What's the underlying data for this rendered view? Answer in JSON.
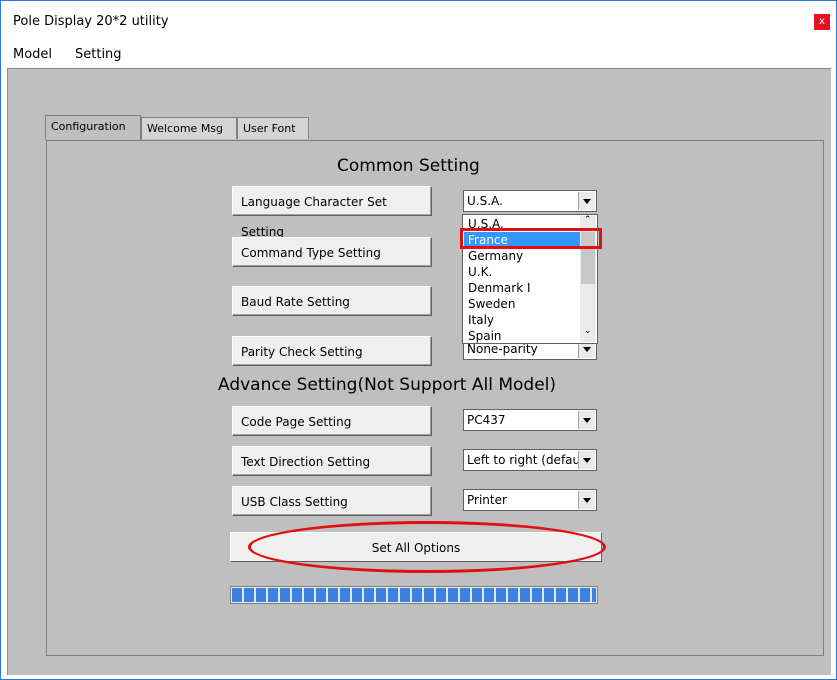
{
  "window": {
    "title": "Pole Display 20*2 utility",
    "close_glyph": "x"
  },
  "menu": [
    "Model",
    "Setting"
  ],
  "tabs": [
    "Configuration",
    "Welcome Msg",
    "User Font"
  ],
  "active_tab": "Configuration",
  "common": {
    "title": "Common Setting",
    "language_button": "Language Character Set Setting",
    "language_value": "U.S.A.",
    "command_button": "Command Type Setting",
    "baud_button": "Baud Rate Setting",
    "parity_button": "Parity Check Setting",
    "parity_value": "None-parity"
  },
  "dropdown": {
    "items": [
      "U.S.A.",
      "France",
      "Germany",
      "U.K.",
      "Denmark I",
      "Sweden",
      "Italy",
      "Spain"
    ],
    "selected": "France"
  },
  "advance": {
    "title": "Advance Setting(Not Support All Model)",
    "codepage_button": "Code Page Setting",
    "codepage_value": "PC437",
    "direction_button": "Text Direction Setting",
    "direction_value": "Left to right (defau",
    "usb_button": "USB Class Setting",
    "usb_value": "Printer"
  },
  "set_all_label": "Set All Options",
  "progress_fraction": 1.0,
  "colors": {
    "highlight": "#e01010",
    "selection": "#3399ff",
    "progress": "#3b82e0"
  }
}
